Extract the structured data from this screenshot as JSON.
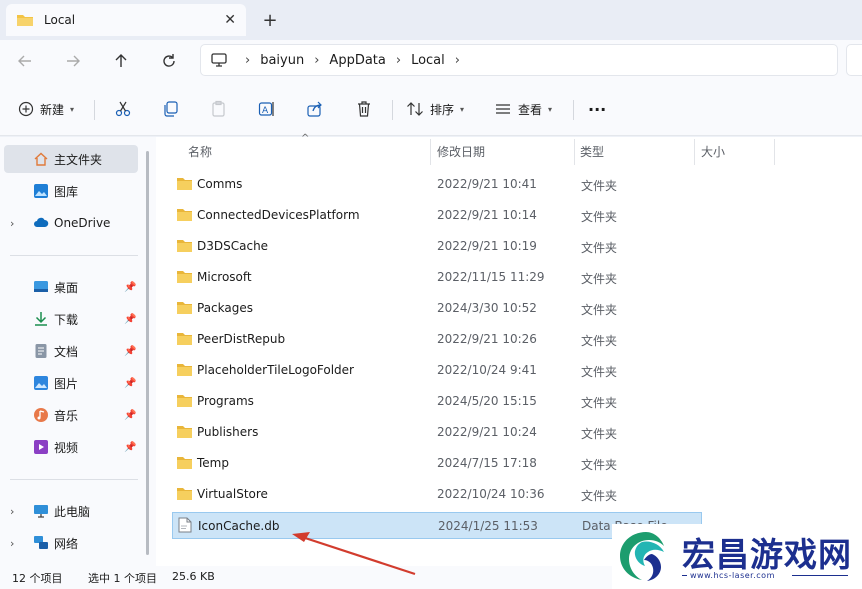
{
  "window": {
    "tab_title": "Local",
    "tab_close": "✕",
    "new_tab": "+"
  },
  "breadcrumbs": [
    "baiyun",
    "AppData",
    "Local"
  ],
  "breadcrumb_sep": "›",
  "toolbar": {
    "new_label": "新建",
    "sort_label": "排序",
    "view_label": "查看",
    "more_label": "···"
  },
  "sidebar": {
    "items": [
      {
        "label": "主文件夹",
        "icon": "home-icon"
      },
      {
        "label": "图库",
        "icon": "gallery-icon"
      },
      {
        "label": "OneDrive",
        "icon": "cloud-icon"
      },
      {
        "label": "桌面",
        "icon": "desktop-icon"
      },
      {
        "label": "下载",
        "icon": "download-icon"
      },
      {
        "label": "文档",
        "icon": "document-icon"
      },
      {
        "label": "图片",
        "icon": "pictures-icon"
      },
      {
        "label": "音乐",
        "icon": "music-icon"
      },
      {
        "label": "视频",
        "icon": "video-icon"
      },
      {
        "label": "此电脑",
        "icon": "computer-icon"
      },
      {
        "label": "网络",
        "icon": "network-icon"
      }
    ]
  },
  "columns": {
    "name": "名称",
    "date": "修改日期",
    "type": "类型",
    "size": "大小"
  },
  "files": [
    {
      "name": "Comms",
      "date": "2022/9/21 10:41",
      "type": "文件夹"
    },
    {
      "name": "ConnectedDevicesPlatform",
      "date": "2022/9/21 10:14",
      "type": "文件夹"
    },
    {
      "name": "D3DSCache",
      "date": "2022/9/21 10:19",
      "type": "文件夹"
    },
    {
      "name": "Microsoft",
      "date": "2022/11/15 11:29",
      "type": "文件夹"
    },
    {
      "name": "Packages",
      "date": "2024/3/30 10:52",
      "type": "文件夹"
    },
    {
      "name": "PeerDistRepub",
      "date": "2022/9/21 10:26",
      "type": "文件夹"
    },
    {
      "name": "PlaceholderTileLogoFolder",
      "date": "2022/10/24 9:41",
      "type": "文件夹"
    },
    {
      "name": "Programs",
      "date": "2024/5/20 15:15",
      "type": "文件夹"
    },
    {
      "name": "Publishers",
      "date": "2022/9/21 10:24",
      "type": "文件夹"
    },
    {
      "name": "Temp",
      "date": "2024/7/15 17:18",
      "type": "文件夹"
    },
    {
      "name": "VirtualStore",
      "date": "2022/10/24 10:36",
      "type": "文件夹"
    },
    {
      "name": "IconCache.db",
      "date": "2024/1/25 11:53",
      "type": "Data Base File"
    }
  ],
  "status": {
    "count": "12 个项目",
    "selection": "选中 1 个项目",
    "size": "25.6 KB"
  },
  "watermark": {
    "text": "宏昌游戏网",
    "url": "www.hcs-laser.com"
  },
  "colors": {
    "folder": "#f3c445",
    "selection": "#cce4f7",
    "arrow": "#d23c2e",
    "watermark": "#1c2f8f"
  }
}
